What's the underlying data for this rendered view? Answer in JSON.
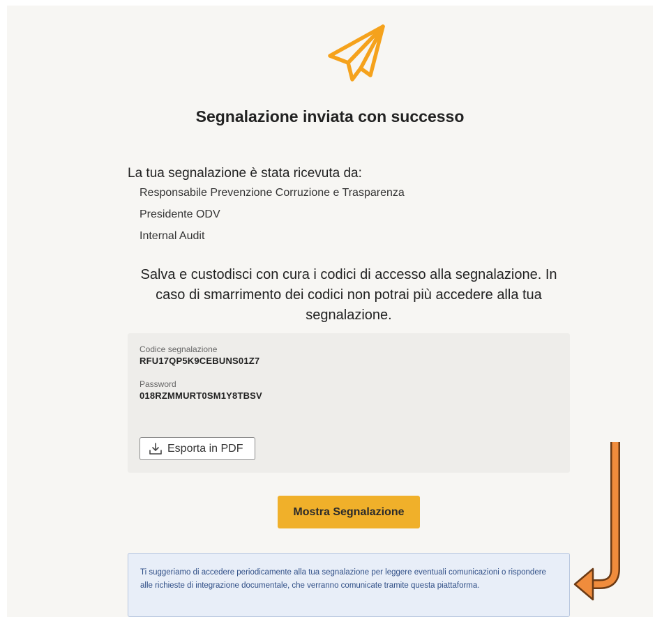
{
  "header": {
    "logo_icon": "paper-plane-icon",
    "title": "Segnalazione inviata con successo"
  },
  "received": {
    "heading": "La tua segnalazione è stata ricevuta da:",
    "recipients": [
      "Responsabile Prevenzione Corruzione e Trasparenza",
      "Presidente ODV",
      "Internal Audit"
    ]
  },
  "warning": {
    "text": "Salva e custodisci con cura i codici di accesso alla segnalazione. In caso di smarrimento dei codici non potrai più accedere alla tua segnalazione."
  },
  "codes": {
    "report_code_label": "Codice segnalazione",
    "report_code_value": "RFU17QP5K9CEBUNS01Z7",
    "password_label": "Password",
    "password_value": "018RZMMURT0SM1Y8TBSV",
    "export_button_label": "Esporta in PDF",
    "export_icon": "download-icon"
  },
  "actions": {
    "show_report_label": "Mostra Segnalazione"
  },
  "info": {
    "text": "Ti suggeriamo di accedere periodicamente alla tua segnalazione per leggere eventuali comunicazioni o rispondere alle richieste di integrazione documentale, che verranno comunicate tramite questa piattaforma."
  },
  "colors": {
    "accent_orange": "#f5a21c",
    "button_yellow": "#f0b02a",
    "info_background": "#e8eef8",
    "info_text": "#2f4e86",
    "annotation_arrow": "#f08c3c"
  }
}
